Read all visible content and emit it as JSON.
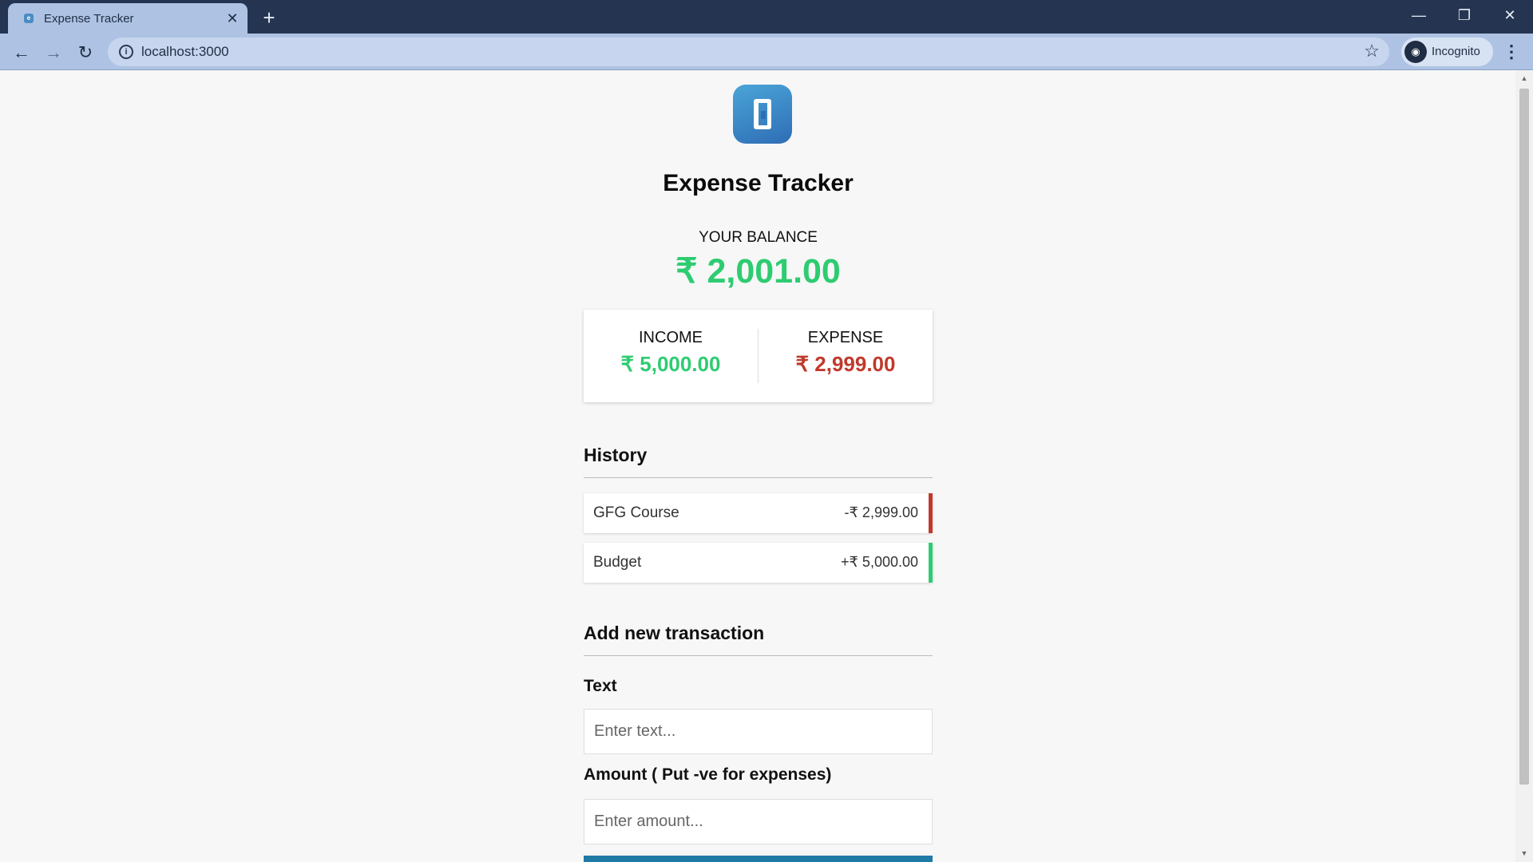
{
  "browser": {
    "tab_title": "Expense Tracker",
    "url": "localhost:3000",
    "profile_label": "Incognito"
  },
  "app": {
    "title": "Expense Tracker",
    "balance_label": "YOUR BALANCE",
    "balance_amount": "₹ 2,001.00",
    "income_label": "INCOME",
    "income_amount": "₹ 5,000.00",
    "expense_label": "EXPENSE",
    "expense_amount": "₹ 2,999.00",
    "colors": {
      "positive": "#2ecc71",
      "negative": "#c0392b"
    }
  },
  "history": {
    "title": "History",
    "items": [
      {
        "text": "GFG Course",
        "amount": "-₹ 2,999.00",
        "type": "expense"
      },
      {
        "text": "Budget",
        "amount": "+₹ 5,000.00",
        "type": "income"
      }
    ]
  },
  "form": {
    "title": "Add new transaction",
    "text_label": "Text",
    "text_placeholder": "Enter text...",
    "amount_label": "Amount ( Put -ve for expenses)",
    "amount_placeholder": "Enter amount..."
  }
}
